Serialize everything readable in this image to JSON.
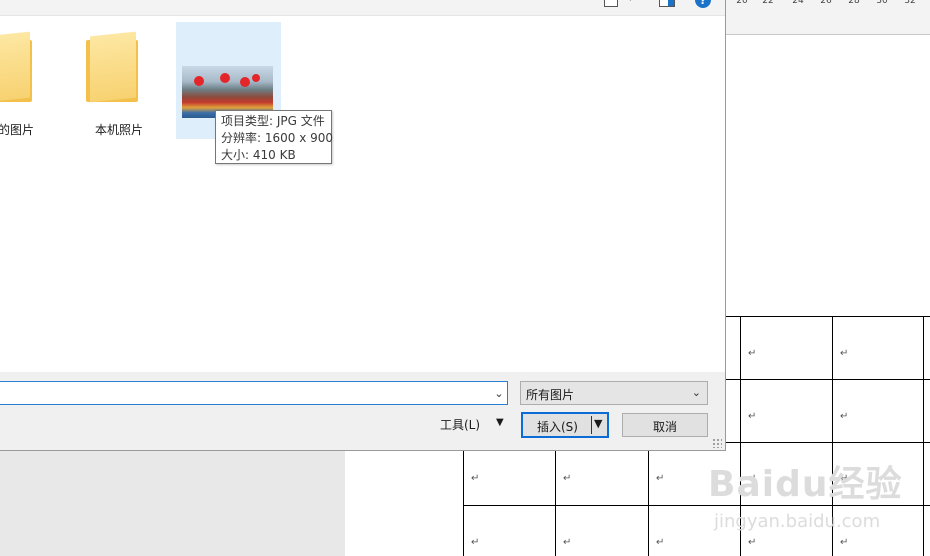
{
  "ruler": {
    "numbers": [
      "20",
      "22",
      "24",
      "26",
      "28",
      "30",
      "32"
    ]
  },
  "dialog": {
    "help_icon_glyph": "?",
    "items": [
      {
        "name": "的图片",
        "icon": "folder-icon"
      },
      {
        "name": "本机照片",
        "icon": "folder-icon"
      },
      {
        "name": "",
        "icon": "image-thumbnail"
      }
    ],
    "tooltip": {
      "type_line": "项目类型: JPG 文件",
      "resolution_line": "分辨率: 1600 x 900",
      "size_line": "大小: 410 KB"
    },
    "filename_input": {
      "value": ""
    },
    "filetype": {
      "selected": "所有图片"
    },
    "tools_label": "工具(L)",
    "insert_label": "插入(S)",
    "cancel_label": "取消"
  },
  "document": {
    "paragraph_mark": "↵"
  },
  "watermark": {
    "logo": "Baidu经验",
    "sub": "jingyan.baidu.com"
  },
  "colors": {
    "accent": "#0a6cd6",
    "selection": "#dfeefb",
    "folder": "#f4c04c"
  }
}
